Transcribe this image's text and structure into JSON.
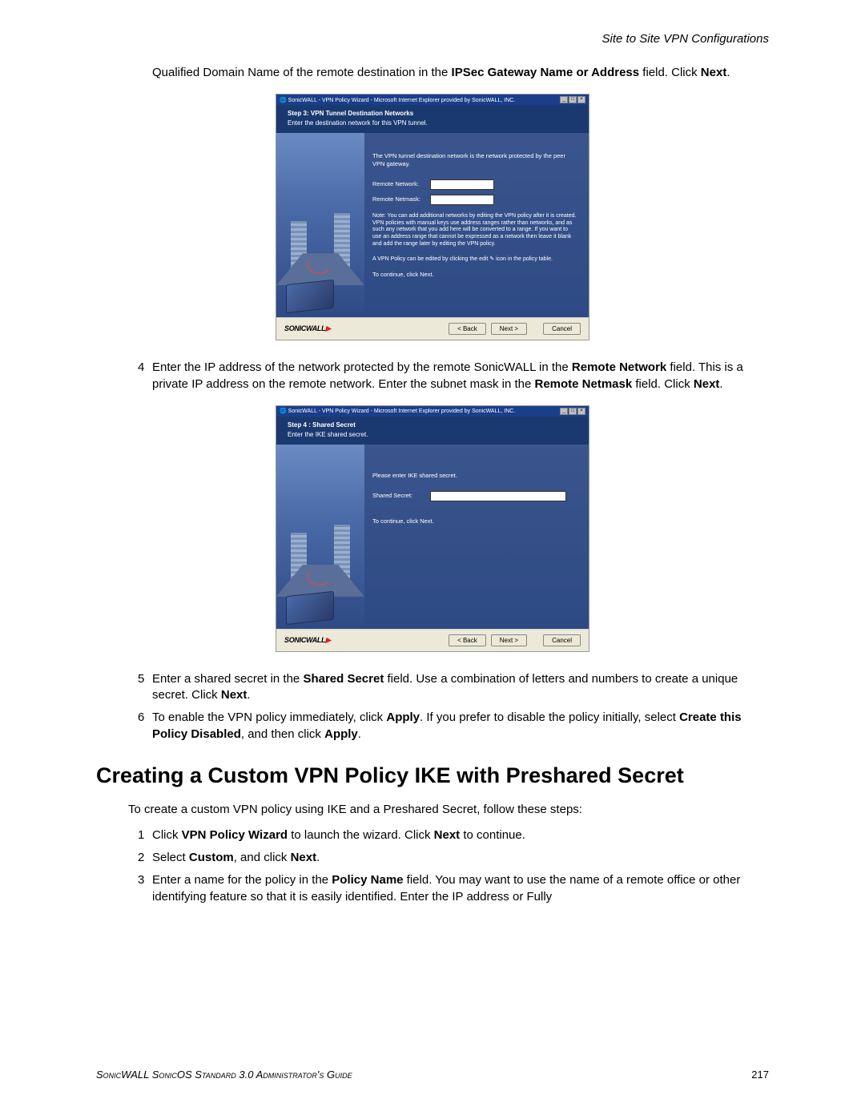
{
  "header": {
    "section_title": "Site to Site VPN Configurations"
  },
  "para_intro": {
    "pre": "Qualified Domain Name of the remote destination in the ",
    "bold1": "IPSec Gateway Name or Address",
    "mid": " field. Click ",
    "bold2": "Next",
    "post": "."
  },
  "screenshot1": {
    "window_title": "SonicWALL - VPN Policy Wizard - Microsoft Internet Explorer provided by SonicWALL, INC.",
    "step_title": "Step 3: VPN Tunnel Destination Networks",
    "step_sub": "Enter the destination network for this VPN tunnel.",
    "desc": "The VPN tunnel destination network is the network protected by the peer VPN gateway.",
    "field1_label": "Remote Network:",
    "field2_label": "Remote Netmask:",
    "note": "Note: You can add additional networks by editing the VPN policy after it is created. VPN policies with manual keys use address ranges rather than networks, and as such any network that you add here will be converted to a range. If you want to use an address range that cannot be expressed as a network then leave it blank and add the range later by editing the VPN policy.",
    "note2": "A VPN Policy can be edited by clicking the edit ✎ icon in the policy table.",
    "continue": "To continue, click Next.",
    "logo": "SONICWALL",
    "back": "< Back",
    "next": "Next >",
    "cancel": "Cancel"
  },
  "item4": {
    "num": "4",
    "t1": "Enter the IP address of the network protected by the remote SonicWALL in the ",
    "b1": "Remote Network",
    "t2": " field. This is a private IP address on the remote network. Enter the subnet mask in the ",
    "b2": "Remote Netmask",
    "t3": " field. Click ",
    "b3": "Next",
    "t4": "."
  },
  "screenshot2": {
    "window_title": "SonicWALL - VPN Policy Wizard - Microsoft Internet Explorer provided by SonicWALL, INC.",
    "step_title": "Step 4 : Shared Secret",
    "step_sub": "Enter the IKE shared secret.",
    "desc": "Please enter IKE shared secret.",
    "field1_label": "Shared Secret:",
    "continue": "To continue, click Next.",
    "logo": "SONICWALL",
    "back": "< Back",
    "next": "Next >",
    "cancel": "Cancel"
  },
  "item5": {
    "num": "5",
    "t1": "Enter a shared secret in the ",
    "b1": "Shared Secret",
    "t2": " field. Use a combination of letters and numbers to create a unique secret. Click ",
    "b2": "Next",
    "t3": "."
  },
  "item6": {
    "num": "6",
    "t1": "To enable the VPN policy immediately, click ",
    "b1": "Apply",
    "t2": ". If you prefer to disable the policy initially, select ",
    "b2": "Create this Policy Disabled",
    "t3": ", and then click ",
    "b3": "Apply",
    "t4": "."
  },
  "heading": "Creating a Custom VPN Policy IKE with Preshared Secret",
  "intro": "To create a custom VPN policy using IKE and a Preshared Secret, follow these steps:",
  "step1": {
    "num": "1",
    "t1": "Click ",
    "b1": "VPN Policy Wizard",
    "t2": " to launch the wizard. Click ",
    "b2": "Next",
    "t3": " to continue."
  },
  "step2": {
    "num": "2",
    "t1": "Select ",
    "b1": "Custom",
    "t2": ", and click ",
    "b2": "Next",
    "t3": "."
  },
  "step3": {
    "num": "3",
    "t1": "Enter a name for the policy in the ",
    "b1": "Policy Name",
    "t2": " field. You may want to use the name of a remote office or other identifying feature so that it is easily identified. Enter the IP address or Fully"
  },
  "footer": {
    "text": "SonicWALL SonicOS Standard 3.0 Administrator's Guide",
    "page": "217"
  }
}
